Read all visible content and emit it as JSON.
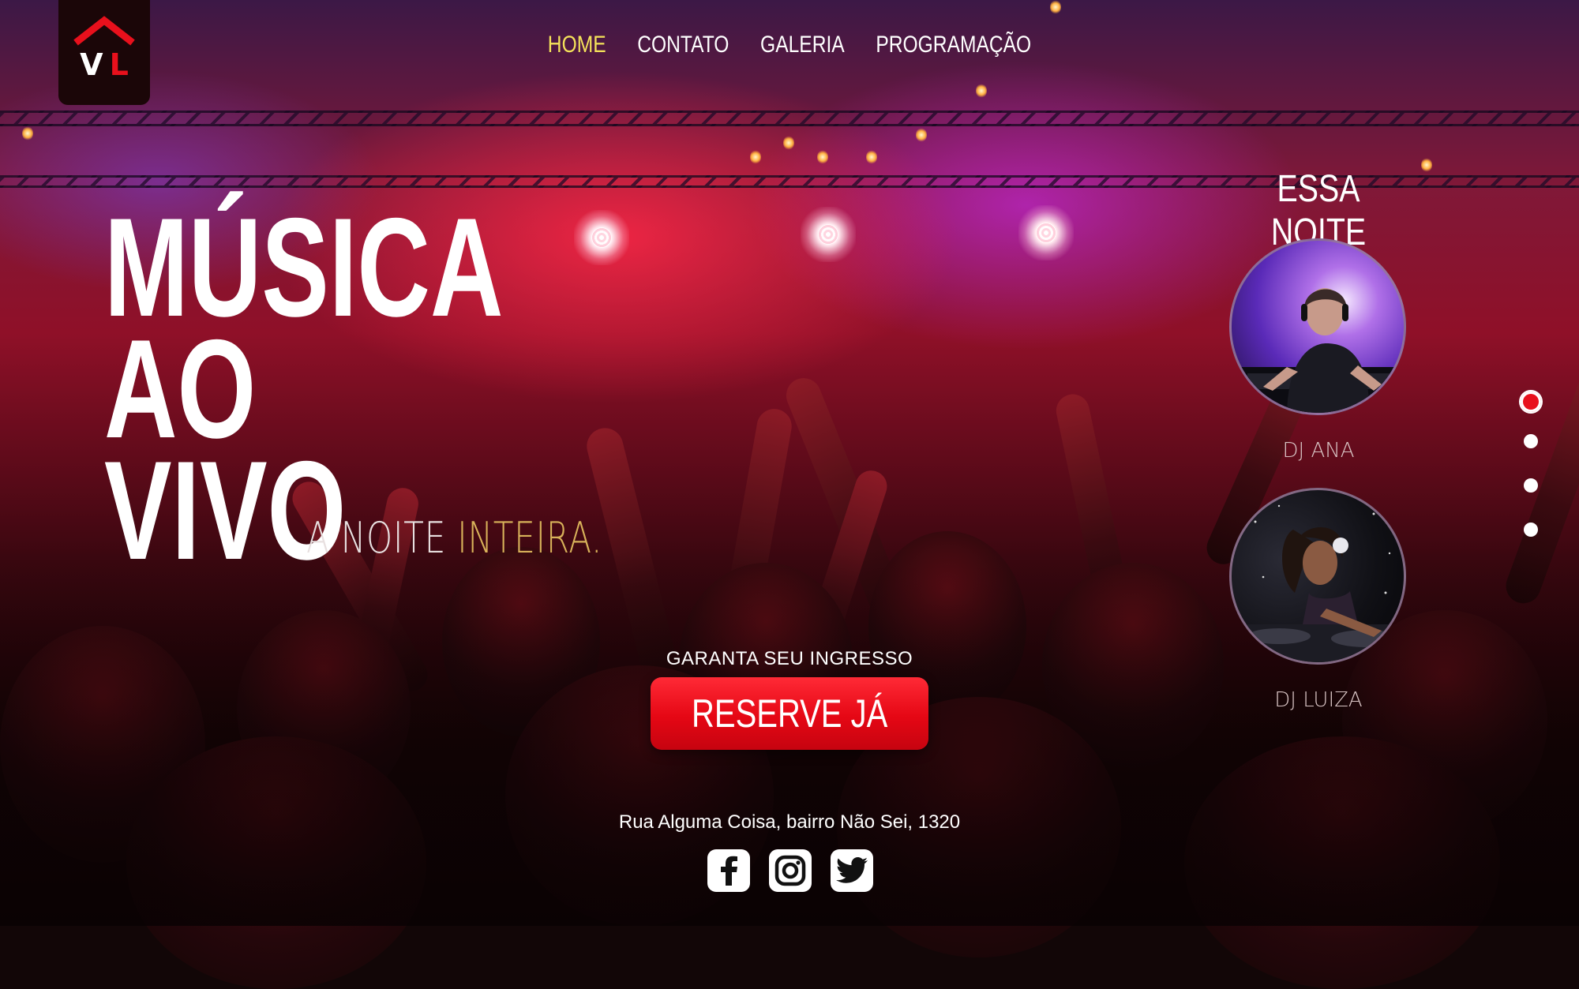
{
  "logo": {
    "letter_v": "V",
    "letter_l": "L"
  },
  "nav": {
    "items": [
      {
        "label": "HOME",
        "active": true
      },
      {
        "label": "CONTATO",
        "active": false
      },
      {
        "label": "GALERIA",
        "active": false
      },
      {
        "label": "PROGRAMAÇÃO",
        "active": false
      }
    ]
  },
  "hero": {
    "line1": "MÚSICA",
    "line2": "AO",
    "line3": "VIVO",
    "tagline_part1": "A NOITE ",
    "tagline_part2": "INTEIRA."
  },
  "cta": {
    "label": "GARANTA SEU INGRESSO",
    "button": "RESERVE JÁ"
  },
  "footer": {
    "address": "Rua Alguma Coisa, bairro Não Sei, 1320",
    "social": [
      "facebook-icon",
      "instagram-icon",
      "twitter-icon"
    ]
  },
  "tonight": {
    "title": "ESSA NOITE",
    "djs": [
      {
        "name": "DJ ANA"
      },
      {
        "name": "DJ LUIZA"
      }
    ]
  },
  "slider": {
    "total": 4,
    "active_index": 0
  },
  "colors": {
    "accent_red": "#e8101c",
    "nav_active": "#f4e25a",
    "tagline_gold": "#d8b25a"
  }
}
